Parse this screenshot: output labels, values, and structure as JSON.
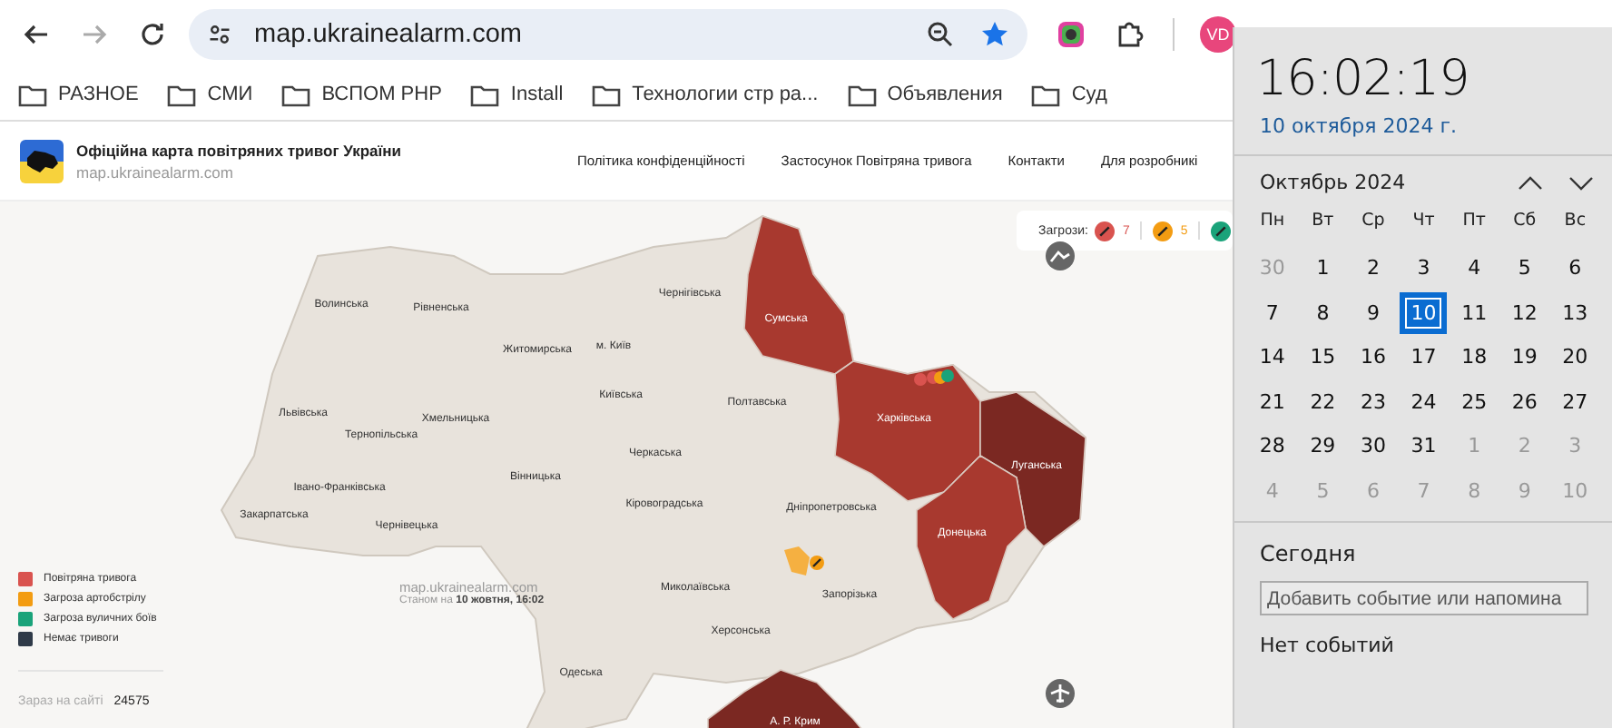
{
  "browser": {
    "url": "map.ukrainealarm.com",
    "avatar": "VD",
    "bookmarks": [
      "РАЗНОЕ",
      "СМИ",
      "ВСПОМ PHP",
      "Install",
      "Технологии стр ра...",
      "Объявления",
      "Суд"
    ]
  },
  "site": {
    "title": "Офіційна карта повітряних тривог України",
    "subtitle": "map.ukrainealarm.com",
    "nav": [
      "Політика конфіденційності",
      "Застосунок Повітряна тривога",
      "Контакти",
      "Для розробникі"
    ]
  },
  "threats": {
    "label": "Загрози:",
    "items": [
      {
        "color": "#d9534f",
        "count": "7"
      },
      {
        "color": "#f39c12",
        "count": "5"
      },
      {
        "color": "#1aa37a"
      }
    ]
  },
  "regions": [
    {
      "name": "Волинська",
      "alarm": false,
      "long_term": false
    },
    {
      "name": "Рівненська",
      "alarm": false,
      "long_term": false
    },
    {
      "name": "Житомирська",
      "alarm": false,
      "long_term": false
    },
    {
      "name": "м. Київ",
      "alarm": false,
      "long_term": false
    },
    {
      "name": "Київська",
      "alarm": false,
      "long_term": false
    },
    {
      "name": "Чернігівська",
      "alarm": false,
      "long_term": false
    },
    {
      "name": "Сумська",
      "alarm": true,
      "long_term": false
    },
    {
      "name": "Полтавська",
      "alarm": false,
      "long_term": false
    },
    {
      "name": "Харківська",
      "alarm": true,
      "long_term": false
    },
    {
      "name": "Луганська",
      "alarm": true,
      "long_term": true
    },
    {
      "name": "Донецька",
      "alarm": true,
      "long_term": false
    },
    {
      "name": "Черкаська",
      "alarm": false,
      "long_term": false
    },
    {
      "name": "Львівська",
      "alarm": false,
      "long_term": false
    },
    {
      "name": "Тернопільська",
      "alarm": false,
      "long_term": false
    },
    {
      "name": "Хмельницька",
      "alarm": false,
      "long_term": false
    },
    {
      "name": "Вінницька",
      "alarm": false,
      "long_term": false
    },
    {
      "name": "Кіровоградська",
      "alarm": false,
      "long_term": false
    },
    {
      "name": "Дніпропетровська",
      "alarm": false,
      "long_term": false
    },
    {
      "name": "Івано-Франківська",
      "alarm": false,
      "long_term": false
    },
    {
      "name": "Закарпатська",
      "alarm": false,
      "long_term": false
    },
    {
      "name": "Чернівецька",
      "alarm": false,
      "long_term": false
    },
    {
      "name": "Миколаївська",
      "alarm": false,
      "long_term": false
    },
    {
      "name": "Запорізька",
      "alarm": false,
      "long_term": false
    },
    {
      "name": "Херсонська",
      "alarm": false,
      "long_term": false
    },
    {
      "name": "Одеська",
      "alarm": false,
      "long_term": false
    },
    {
      "name": "А. Р. Крим",
      "alarm": true,
      "long_term": true
    }
  ],
  "watermark": {
    "site": "map.ukrainealarm.com",
    "as_of": "Станом на **10 жовтня, 16:02**"
  },
  "legend": [
    {
      "label": "Повітряна тривога",
      "color": "#d9534f"
    },
    {
      "label": "Загроза артобстрілу",
      "color": "#f39c12"
    },
    {
      "label": "Загроза вуличних боїв",
      "color": "#1aa37a"
    },
    {
      "label": "Немає тривоги",
      "color": "#2f3a48"
    }
  ],
  "online": {
    "label": "Зараз на сайті",
    "count": "24575"
  },
  "calendar": {
    "time": "16:02:19",
    "date": "10 октября 2024 г.",
    "month": "Октябрь 2024",
    "weekdays": [
      "Пн",
      "Вт",
      "Ср",
      "Чт",
      "Пт",
      "Сб",
      "Вс"
    ],
    "weeks": [
      [
        {
          "day": "30",
          "other_month": true,
          "selected": false
        },
        {
          "day": "1",
          "other_month": false,
          "selected": false
        },
        {
          "day": "2",
          "other_month": false,
          "selected": false
        },
        {
          "day": "3",
          "other_month": false,
          "selected": false
        },
        {
          "day": "4",
          "other_month": false,
          "selected": false
        },
        {
          "day": "5",
          "other_month": false,
          "selected": false
        },
        {
          "day": "6",
          "other_month": false,
          "selected": false
        }
      ],
      [
        {
          "day": "7",
          "other_month": false,
          "selected": false
        },
        {
          "day": "8",
          "other_month": false,
          "selected": false
        },
        {
          "day": "9",
          "other_month": false,
          "selected": false
        },
        {
          "day": "10",
          "other_month": false,
          "selected": true
        },
        {
          "day": "11",
          "other_month": false,
          "selected": false
        },
        {
          "day": "12",
          "other_month": false,
          "selected": false
        },
        {
          "day": "13",
          "other_month": false,
          "selected": false
        }
      ],
      [
        {
          "day": "14",
          "other_month": false,
          "selected": false
        },
        {
          "day": "15",
          "other_month": false,
          "selected": false
        },
        {
          "day": "16",
          "other_month": false,
          "selected": false
        },
        {
          "day": "17",
          "other_month": false,
          "selected": false
        },
        {
          "day": "18",
          "other_month": false,
          "selected": false
        },
        {
          "day": "19",
          "other_month": false,
          "selected": false
        },
        {
          "day": "20",
          "other_month": false,
          "selected": false
        }
      ],
      [
        {
          "day": "21",
          "other_month": false,
          "selected": false
        },
        {
          "day": "22",
          "other_month": false,
          "selected": false
        },
        {
          "day": "23",
          "other_month": false,
          "selected": false
        },
        {
          "day": "24",
          "other_month": false,
          "selected": false
        },
        {
          "day": "25",
          "other_month": false,
          "selected": false
        },
        {
          "day": "26",
          "other_month": false,
          "selected": false
        },
        {
          "day": "27",
          "other_month": false,
          "selected": false
        }
      ],
      [
        {
          "day": "28",
          "other_month": false,
          "selected": false
        },
        {
          "day": "29",
          "other_month": false,
          "selected": false
        },
        {
          "day": "30",
          "other_month": false,
          "selected": false
        },
        {
          "day": "31",
          "other_month": false,
          "selected": false
        },
        {
          "day": "1",
          "other_month": true,
          "selected": false
        },
        {
          "day": "2",
          "other_month": true,
          "selected": false
        },
        {
          "day": "3",
          "other_month": true,
          "selected": false
        }
      ],
      [
        {
          "day": "4",
          "other_month": true,
          "selected": false
        },
        {
          "day": "5",
          "other_month": true,
          "selected": false
        },
        {
          "day": "6",
          "other_month": true,
          "selected": false
        },
        {
          "day": "7",
          "other_month": true,
          "selected": false
        },
        {
          "day": "8",
          "other_month": true,
          "selected": false
        },
        {
          "day": "9",
          "other_month": true,
          "selected": false
        },
        {
          "day": "10",
          "other_month": true,
          "selected": false
        }
      ]
    ],
    "today_label": "Сегодня",
    "event_placeholder": "Добавить событие или напомина",
    "no_events": "Нет событий"
  }
}
